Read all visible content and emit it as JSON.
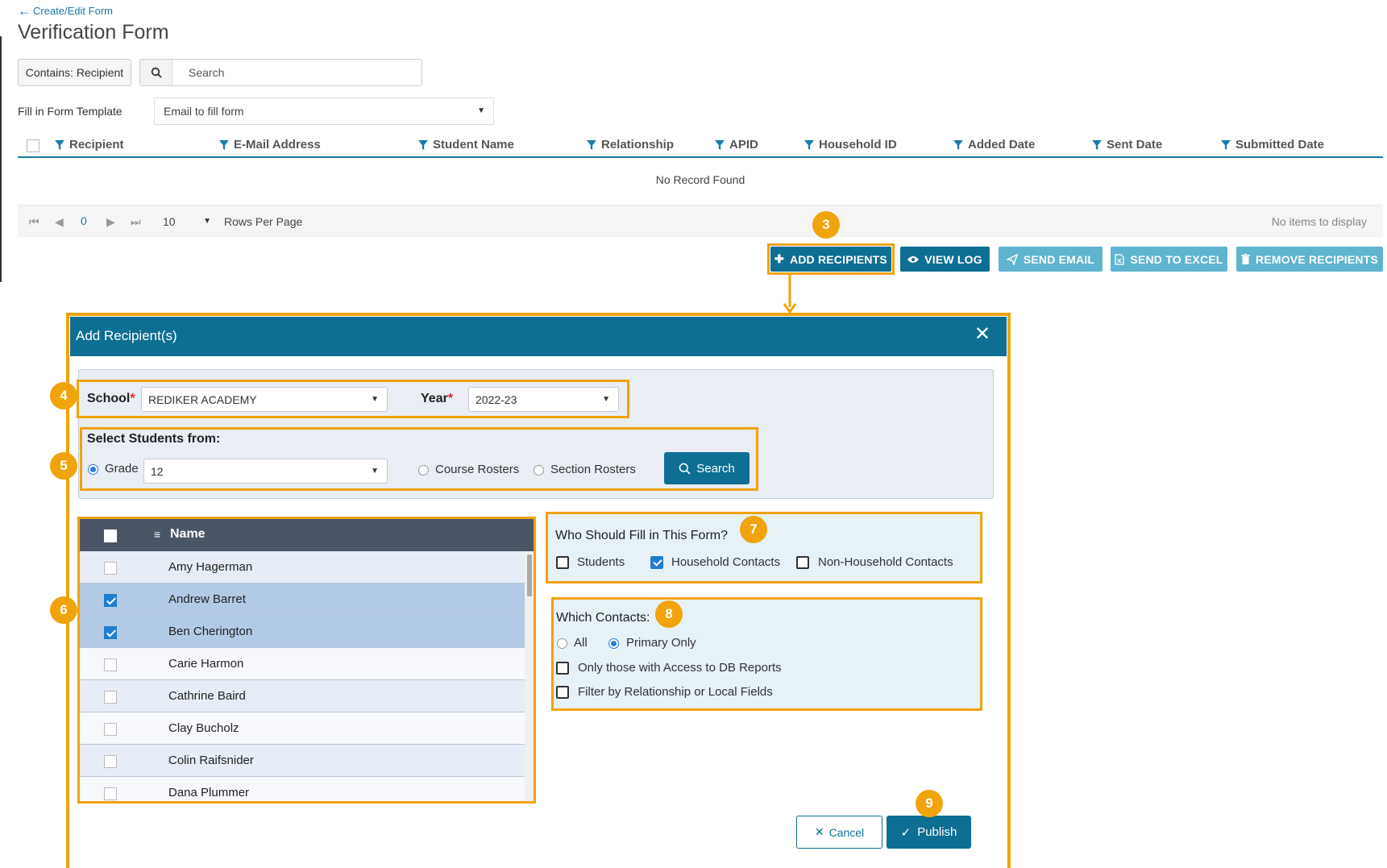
{
  "header": {
    "back_link": "Create/Edit Form",
    "title": "Verification Form"
  },
  "toolbar": {
    "contains_label": "Contains: Recipient",
    "search_placeholder": "Search",
    "template_label": "Fill in Form Template",
    "template_value": "Email to fill form"
  },
  "grid": {
    "columns": [
      "Recipient",
      "E-Mail Address",
      "Student Name",
      "Relationship",
      "APID",
      "Household ID",
      "Added Date",
      "Sent Date",
      "Submitted Date"
    ],
    "empty_text": "No Record Found",
    "pager": {
      "page": "0",
      "rows_per_page": "10",
      "rows_per_page_label": "Rows Per Page",
      "items_text": "No items to display"
    }
  },
  "actions": {
    "add_recipients": "ADD RECIPIENTS",
    "view_log": "VIEW LOG",
    "send_email": "SEND EMAIL",
    "send_to_excel": "SEND TO EXCEL",
    "remove_recipients": "REMOVE RECIPIENTS"
  },
  "badges": [
    "3",
    "4",
    "5",
    "6",
    "7",
    "8",
    "9"
  ],
  "dialog": {
    "title": "Add Recipient(s)",
    "school_label": "School",
    "school_value": "REDIKER ACADEMY",
    "year_label": "Year",
    "year_value": "2022-23",
    "select_from_label": "Select Students from:",
    "grade_label": "Grade",
    "grade_value": "12",
    "course_rosters": "Course Rosters",
    "section_rosters": "Section Rosters",
    "search_button": "Search",
    "name_column": "Name",
    "students": [
      {
        "name": "Amy Hagerman",
        "checked": false
      },
      {
        "name": "Andrew Barret",
        "checked": true
      },
      {
        "name": "Ben Cherington",
        "checked": true
      },
      {
        "name": "Carie Harmon",
        "checked": false
      },
      {
        "name": "Cathrine Baird",
        "checked": false
      },
      {
        "name": "Clay Bucholz",
        "checked": false
      },
      {
        "name": "Colin Raifsnider",
        "checked": false
      },
      {
        "name": "Dana Plummer",
        "checked": false
      }
    ],
    "who_title": "Who Should Fill in This Form?",
    "who_options": {
      "students": "Students",
      "household": "Household Contacts",
      "non_household": "Non-Household Contacts"
    },
    "which_title": "Which Contacts:",
    "which_all": "All",
    "which_primary": "Primary Only",
    "db_reports": "Only those with Access to DB Reports",
    "filter_relationship": "Filter by Relationship or Local Fields",
    "cancel": "Cancel",
    "publish": "Publish"
  },
  "colors": {
    "primary": "#0f6e93",
    "primary_light": "#5fb4cf",
    "highlight": "#f0a30a",
    "grid_header": "#4a5566",
    "selected_row": "#b3cae4"
  }
}
